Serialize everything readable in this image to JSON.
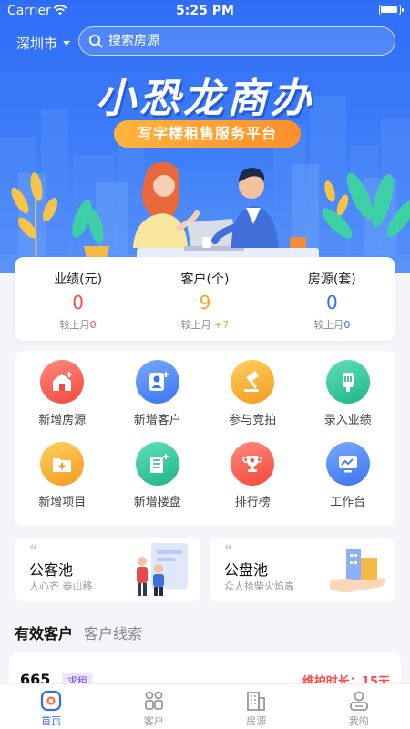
{
  "status_bar": {
    "carrier": "Carrier",
    "time": "5:25 PM"
  },
  "header": {
    "city": "深圳市",
    "search_placeholder": "搜索房源",
    "banner_title": "小恐龙商办",
    "banner_subtitle": "写字楼租售服务平台"
  },
  "stats": [
    {
      "label": "业绩(元)",
      "value": "0",
      "compare_text": "较上月",
      "delta": "0",
      "color": "#ff4a4a"
    },
    {
      "label": "客户(个)",
      "value": "9",
      "compare_text": "较上月",
      "delta": "+7",
      "color": "#f6a623"
    },
    {
      "label": "房源(套)",
      "value": "0",
      "compare_text": "较上月",
      "delta": "0",
      "color": "#2f6df6"
    }
  ],
  "actions": [
    {
      "label": "新增房源",
      "icon": "add-house-icon",
      "color": "red"
    },
    {
      "label": "新增客户",
      "icon": "add-customer-icon",
      "color": "blue"
    },
    {
      "label": "参与竞拍",
      "icon": "auction-hammer-icon",
      "color": "orange"
    },
    {
      "label": "录入业绩",
      "icon": "record-performance-icon",
      "color": "green"
    },
    {
      "label": "新增项目",
      "icon": "add-project-folder-icon",
      "color": "orange"
    },
    {
      "label": "新增楼盘",
      "icon": "add-building-icon",
      "color": "green"
    },
    {
      "label": "排行榜",
      "icon": "trophy-icon",
      "color": "red"
    },
    {
      "label": "工作台",
      "icon": "monitor-icon",
      "color": "blue"
    }
  ],
  "pools": [
    {
      "title": "公客池",
      "desc": "人心齐 泰山移"
    },
    {
      "title": "公盘池",
      "desc": "众人拾柴火焰高"
    }
  ],
  "tabs": {
    "active": "有效客户",
    "inactive": "客户线索"
  },
  "peek_card": {
    "number": "665",
    "badge": "求租",
    "maintain": "维护时长：15天"
  },
  "bottom_nav": [
    {
      "label": "首页",
      "icon": "home-icon",
      "active": true
    },
    {
      "label": "客户",
      "icon": "customers-icon",
      "active": false
    },
    {
      "label": "房源",
      "icon": "building-icon",
      "active": false
    },
    {
      "label": "我的",
      "icon": "profile-icon",
      "active": false
    }
  ],
  "colors": {
    "brand_blue": "#2f6df6",
    "accent_orange": "#f6a623",
    "alert_red": "#ff4a4a"
  }
}
